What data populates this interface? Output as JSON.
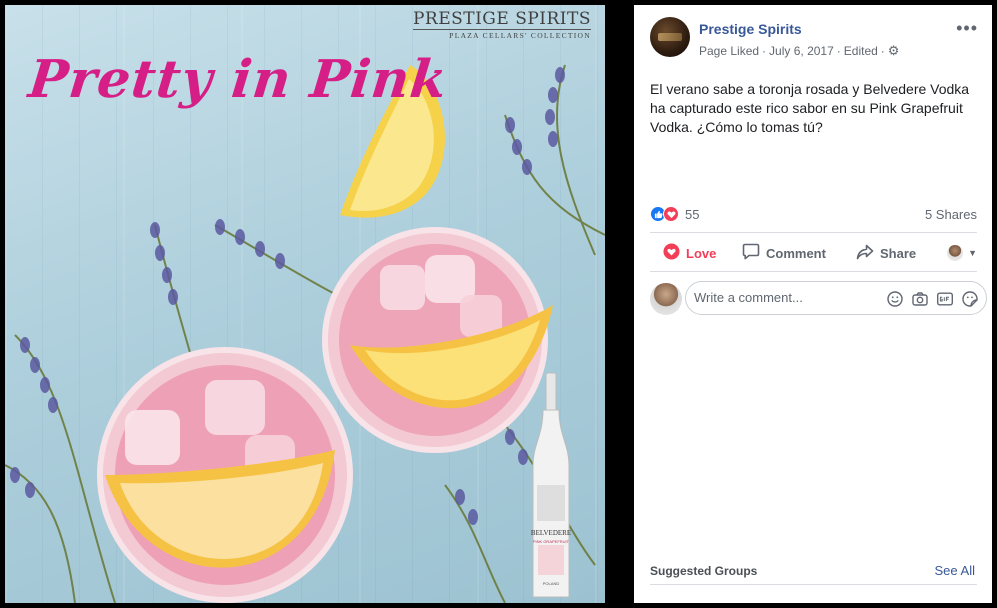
{
  "photo": {
    "brand_name": "PRESTIGE SPIRITS",
    "brand_sub": "PLAZA CELLARS' COLLECTION",
    "headline": "Pretty in Pink",
    "bottle_brand": "BELVEDERE",
    "bottle_flavor": "PINK GRAPEFRUIT",
    "bottle_origin": "POLAND"
  },
  "post": {
    "page_name": "Prestige Spirits",
    "status": "Page Liked",
    "date": "July 6, 2017",
    "edited": "Edited",
    "text": "El verano sabe a toronja rosada y Belvedere Vodka ha capturado este rico sabor en su Pink Grapefruit Vodka. ¿Cómo lo tomas tú?",
    "reaction_count": "55",
    "shares": "5 Shares"
  },
  "actions": {
    "love": "Love",
    "comment": "Comment",
    "share": "Share"
  },
  "comment": {
    "placeholder": "Write a comment..."
  },
  "suggested": {
    "title": "Suggested Groups",
    "see_all": "See All"
  },
  "colors": {
    "link": "#385898",
    "love": "#f33e58",
    "like": "#1877f2",
    "headline_pink": "#d61f86"
  }
}
